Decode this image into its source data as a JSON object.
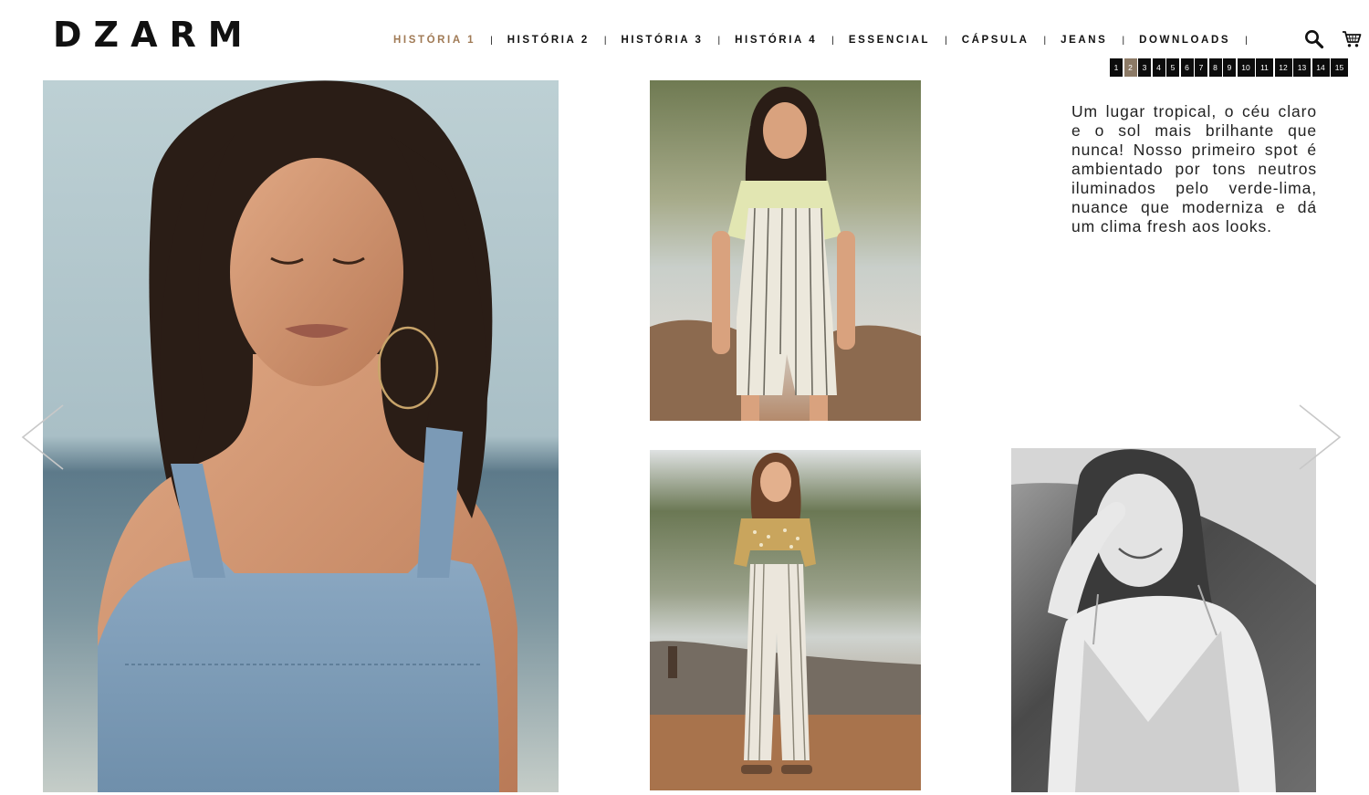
{
  "brand": {
    "logo_text": "DZARM"
  },
  "nav": {
    "items": [
      {
        "label": "HISTÓRIA 1",
        "active": true
      },
      {
        "label": "HISTÓRIA 2",
        "active": false
      },
      {
        "label": "HISTÓRIA 3",
        "active": false
      },
      {
        "label": "HISTÓRIA 4",
        "active": false
      },
      {
        "label": "ESSENCIAL",
        "active": false
      },
      {
        "label": "CÁPSULA",
        "active": false
      },
      {
        "label": "JEANS",
        "active": false
      },
      {
        "label": "DOWNLOADS",
        "active": false
      }
    ],
    "separator": "|",
    "active_color": "#a07a55"
  },
  "icons": {
    "search": "search-icon",
    "cart": "cart-icon",
    "prev": "chevron-left-icon",
    "next": "chevron-right-icon"
  },
  "pagination": {
    "pages": [
      "1",
      "2",
      "3",
      "4",
      "5",
      "6",
      "7",
      "8",
      "9",
      "10",
      "11",
      "12",
      "13",
      "14",
      "15"
    ],
    "current": "2",
    "active_color": "#8c7a66"
  },
  "intro": {
    "text": "Um lugar tropical, o céu claro e o sol mais brilhante que nunca! Nosso primeiro spot é ambientado por tons neutros iluminados pelo verde-lima, nuance que moderniza e dá um clima fresh aos looks."
  },
  "photos": [
    {
      "name": "photo-model-denim-closeup"
    },
    {
      "name": "photo-model-striped-overalls"
    },
    {
      "name": "photo-model-striped-pants"
    },
    {
      "name": "photo-model-bw-smiling"
    }
  ]
}
